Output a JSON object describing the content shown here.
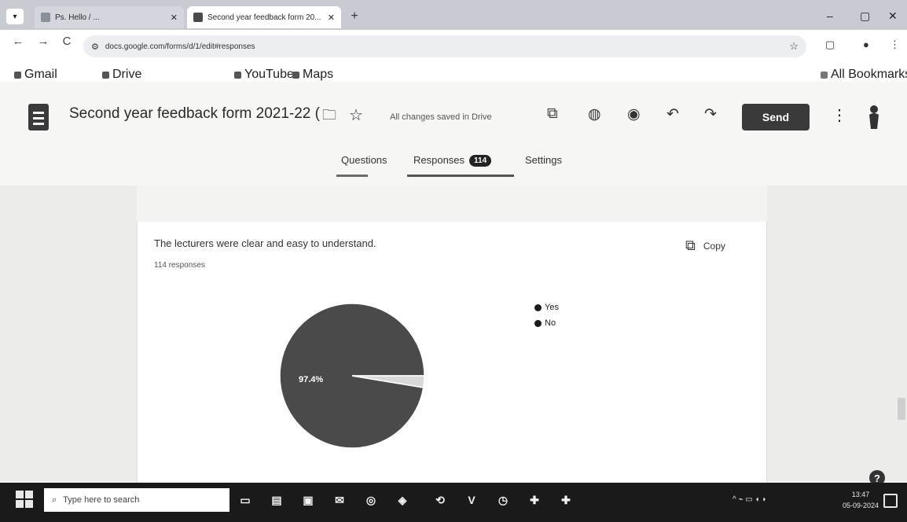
{
  "browser": {
    "tabs": [
      {
        "title": "Ps. Hello / ...",
        "active": false
      },
      {
        "title": "Second year feedback form 20...",
        "active": true
      }
    ],
    "new_tab": "+",
    "window_controls": {
      "minimize": "–",
      "maximize": "▢",
      "close": "✕"
    },
    "nav": {
      "back": "←",
      "forward": "→",
      "reload": "C"
    },
    "address": "docs.google.com/forms/d/1/edit#responses",
    "bookmarks": [
      "Gmail",
      "Drive",
      "YouTube",
      "Maps"
    ],
    "all_bookmarks": "All Bookmarks"
  },
  "form": {
    "title": "Second year feedback form 2021-22 (",
    "saved_status": "All changes saved in Drive",
    "send_label": "Send",
    "tabs": {
      "questions": "Questions",
      "responses": "Responses",
      "responses_count": "114",
      "settings": "Settings"
    }
  },
  "question_card": {
    "question": "The lecturers were clear and easy to understand.",
    "responses": "114 responses",
    "copy_label": "Copy"
  },
  "chart_data": {
    "type": "pie",
    "categories": [
      "Yes",
      "No"
    ],
    "values": [
      97.4,
      2.6
    ],
    "slice_label": "97.4%",
    "legend_position": "right",
    "colors": [
      "#4a4a4a",
      "#d9d9d9"
    ]
  },
  "help_icon": "?",
  "taskbar": {
    "search_placeholder": "Type here to search",
    "clock_time": "13:47",
    "clock_date": "05-09-2024"
  }
}
